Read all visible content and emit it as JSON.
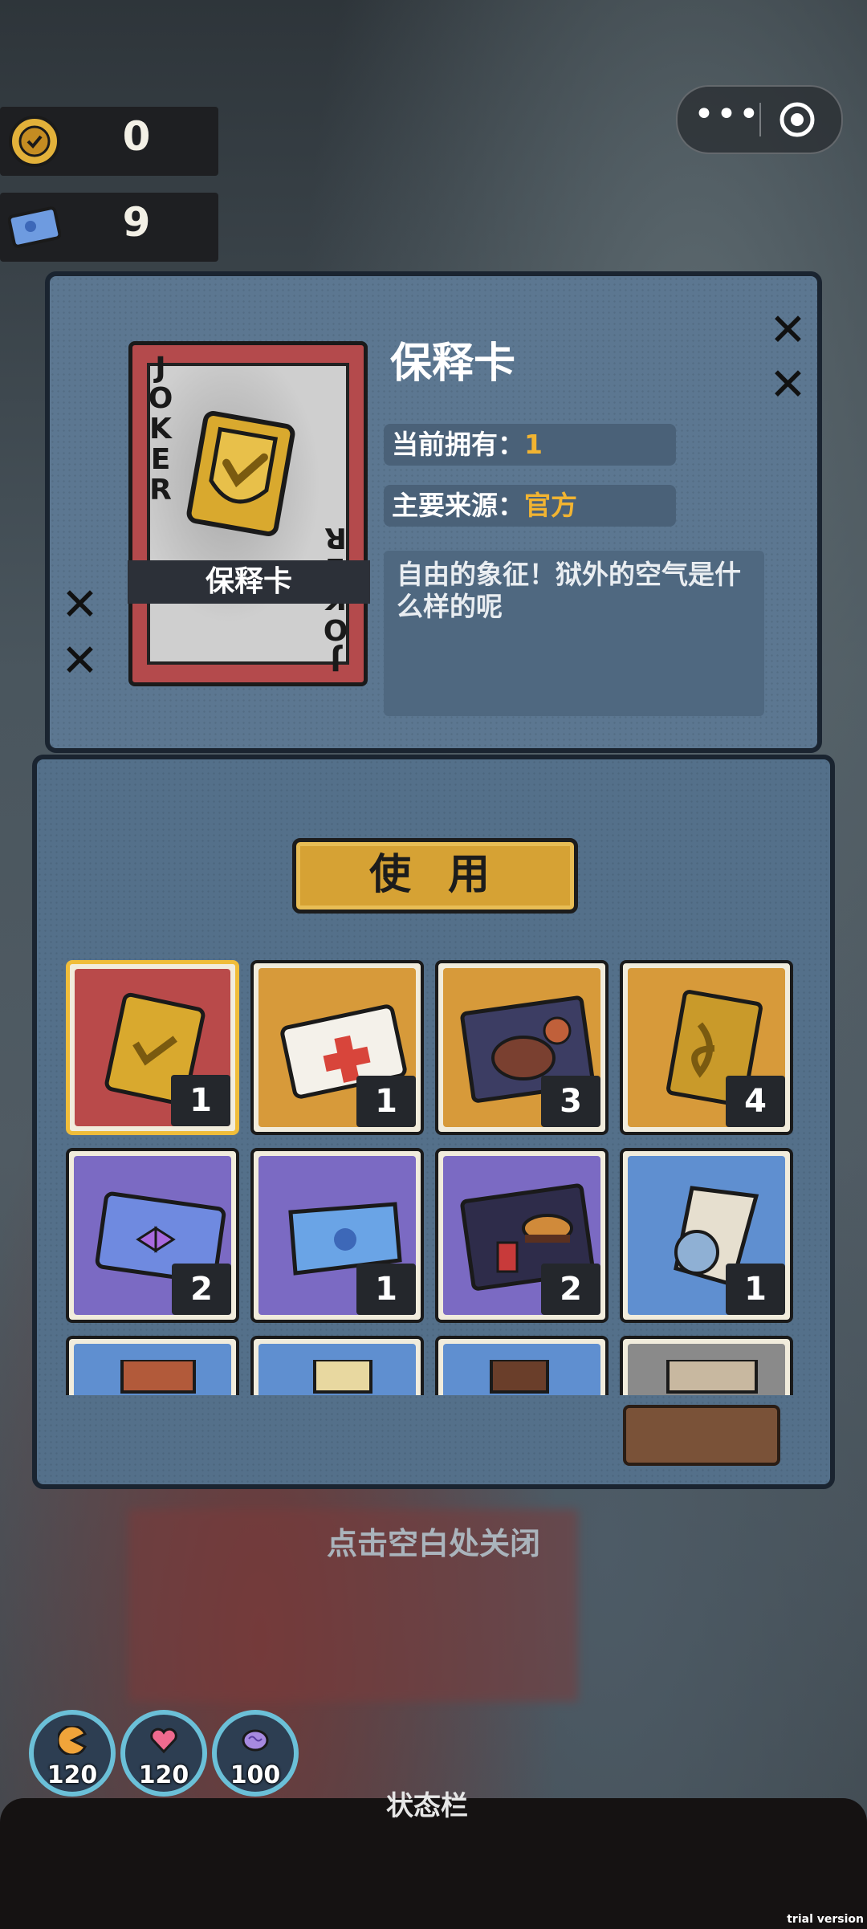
{
  "currencies": [
    {
      "icon": "gold-coin-icon",
      "value": "0"
    },
    {
      "icon": "blue-ticket-icon",
      "value": "9"
    }
  ],
  "capsule": {
    "more_icon": "more-dots-icon",
    "close_icon": "target-circle-icon"
  },
  "detail": {
    "card_corner": "JOKER",
    "card_banner": "保释卡",
    "title": "保释卡",
    "owned_label": "当前拥有：",
    "owned_value": "1",
    "source_label": "主要来源：",
    "source_value": "官方",
    "description": "自由的象征！狱外的空气是什么样的呢"
  },
  "use_button": "使 用",
  "items": [
    {
      "name": "bail-card",
      "count": "1",
      "bg": "#b94a4a",
      "selected": true
    },
    {
      "name": "medical-card",
      "count": "1",
      "bg": "#d79a3a"
    },
    {
      "name": "steak-meal",
      "count": "3",
      "bg": "#d79a3a"
    },
    {
      "name": "gold-card",
      "count": "4",
      "bg": "#d79a3a"
    },
    {
      "name": "toy-ticket",
      "count": "2",
      "bg": "#7b6ac3"
    },
    {
      "name": "blue-ticket",
      "count": "1",
      "bg": "#7b6ac3"
    },
    {
      "name": "burger-meal",
      "count": "2",
      "bg": "#7b6ac3"
    },
    {
      "name": "newspaper-badge",
      "count": "1",
      "bg": "#5f8fd0"
    },
    {
      "name": "item-9",
      "count": "",
      "bg": "#5f8fd0"
    },
    {
      "name": "item-10",
      "count": "",
      "bg": "#5f8fd0"
    },
    {
      "name": "item-11",
      "count": "",
      "bg": "#5f8fd0"
    },
    {
      "name": "item-12",
      "count": "",
      "bg": "#8a8a8a"
    }
  ],
  "close_hint": "点击空白处关闭",
  "stats": [
    {
      "icon": "food-icon",
      "value": "120"
    },
    {
      "icon": "heart-icon",
      "value": "120"
    },
    {
      "icon": "brain-icon",
      "value": "100"
    }
  ],
  "status_title": "状态栏",
  "watermark": "trial version"
}
